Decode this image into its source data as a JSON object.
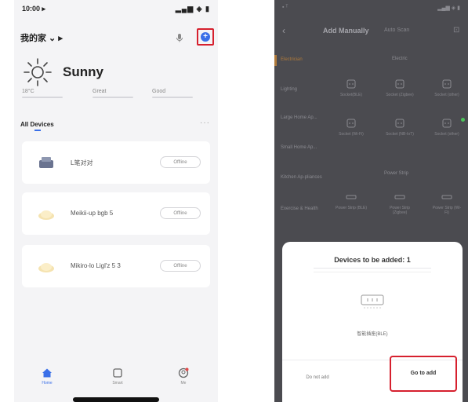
{
  "left_app": {
    "status_bar": {
      "time": "10:00 ▸",
      "signals": "▂▄▆ ◈ ▮"
    },
    "home_title": "我的家 ⌄ ▸",
    "add_button_label": "+",
    "weather": {
      "condition": "Sunny",
      "icon": "sun-icon"
    },
    "weather_stats": [
      {
        "value": "18°C"
      },
      {
        "value": "Great"
      },
      {
        "value": "Good"
      }
    ],
    "section": {
      "label": "All Devices",
      "more": "···"
    },
    "devices": [
      {
        "name": "L笔对对",
        "status": "Offline",
        "icon": "device-hub-icon"
      },
      {
        "name": "Meikii-up bgb 5",
        "status": "Offline",
        "icon": "bulb-icon"
      },
      {
        "name": "Mikiro-lo Ligl'z 5 3",
        "status": "Offline",
        "icon": "bulb-icon"
      }
    ],
    "tabs": [
      {
        "label": "Home",
        "icon": "home-icon",
        "active": true
      },
      {
        "label": "Smart",
        "icon": "square-icon",
        "active": false
      },
      {
        "label": "Me",
        "icon": "profile-icon",
        "active": false
      }
    ]
  },
  "right_app": {
    "status_bar": {
      "time": "▪ ᵀ",
      "signals": "▂▄▆ ◈ ▮"
    },
    "nav": {
      "back": "‹",
      "title": "Add Manually",
      "second_tab": "Auto Scan",
      "scan_icon": "⊡"
    },
    "categories": [
      "Electrician",
      "Lighting",
      "Large Home Ap...",
      "Small Home Ap...",
      "Kitchen Ap-pliances",
      "Exercise & Health"
    ],
    "group_titles": [
      "Electric",
      "Power Strip"
    ],
    "tiles_row1": [
      "Socket(BLE)",
      "Socket (Zigbee)",
      "Socket (other)"
    ],
    "tiles_row2": [
      "Socket (Wi-Fi)",
      "Socket (NB-IoT)",
      "Socket (other)"
    ],
    "tiles_row3": [
      "Power Strip (BLE)",
      "Power Strip (Zigbee)",
      "Power Strip (Wi-Fi)"
    ],
    "dialog": {
      "title": "Devices to be added: 1",
      "device_name": "智能插座(BLE)",
      "cancel_label": "Do not add",
      "confirm_label": "Go to add"
    }
  },
  "colors": {
    "accent_blue": "#3a6fe8",
    "highlight_red": "#d6202e",
    "sidebar_active": "#b07a3a"
  }
}
